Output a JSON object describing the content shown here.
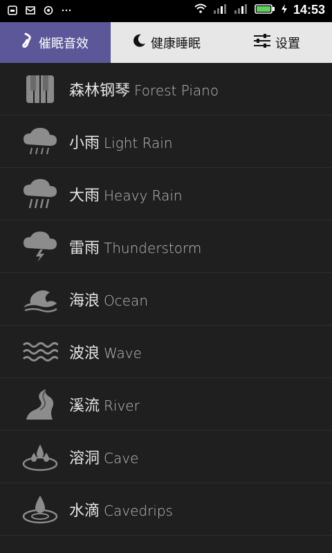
{
  "status": {
    "time": "14:53",
    "left_icons": [
      "clipboard-icon",
      "mail-icon",
      "settings-icon",
      "more-icon"
    ],
    "right_icons": [
      "wifi-icon",
      "signal-icon",
      "signal-2-icon",
      "battery-icon",
      "charging-icon"
    ]
  },
  "tabs": {
    "sleep_sound": {
      "label": "催眠音效",
      "icon": "music-note-icon",
      "active": true
    },
    "healthy_sleep": {
      "label": "健康睡眠",
      "icon": "moon-icon"
    },
    "settings": {
      "label": "设置",
      "icon": "sliders-icon"
    }
  },
  "items": [
    {
      "cn": "森林钢琴",
      "en": "Forest Piano",
      "icon": "piano-icon"
    },
    {
      "cn": "小雨",
      "en": "Light Rain",
      "icon": "light-rain-icon"
    },
    {
      "cn": "大雨",
      "en": "Heavy Rain",
      "icon": "heavy-rain-icon"
    },
    {
      "cn": "雷雨",
      "en": "Thunderstorm",
      "icon": "thunderstorm-icon"
    },
    {
      "cn": "海浪",
      "en": "Ocean",
      "icon": "ocean-icon"
    },
    {
      "cn": "波浪",
      "en": "Wave",
      "icon": "wave-icon"
    },
    {
      "cn": "溪流",
      "en": "River",
      "icon": "river-icon"
    },
    {
      "cn": "溶洞",
      "en": "Cave",
      "icon": "cave-icon"
    },
    {
      "cn": "水滴",
      "en": "Cavedrips",
      "icon": "cavedrips-icon"
    }
  ],
  "colors": {
    "active_tab": "#5b5799",
    "background": "#1f1f1f",
    "tab_bar": "#e7e7e7"
  }
}
